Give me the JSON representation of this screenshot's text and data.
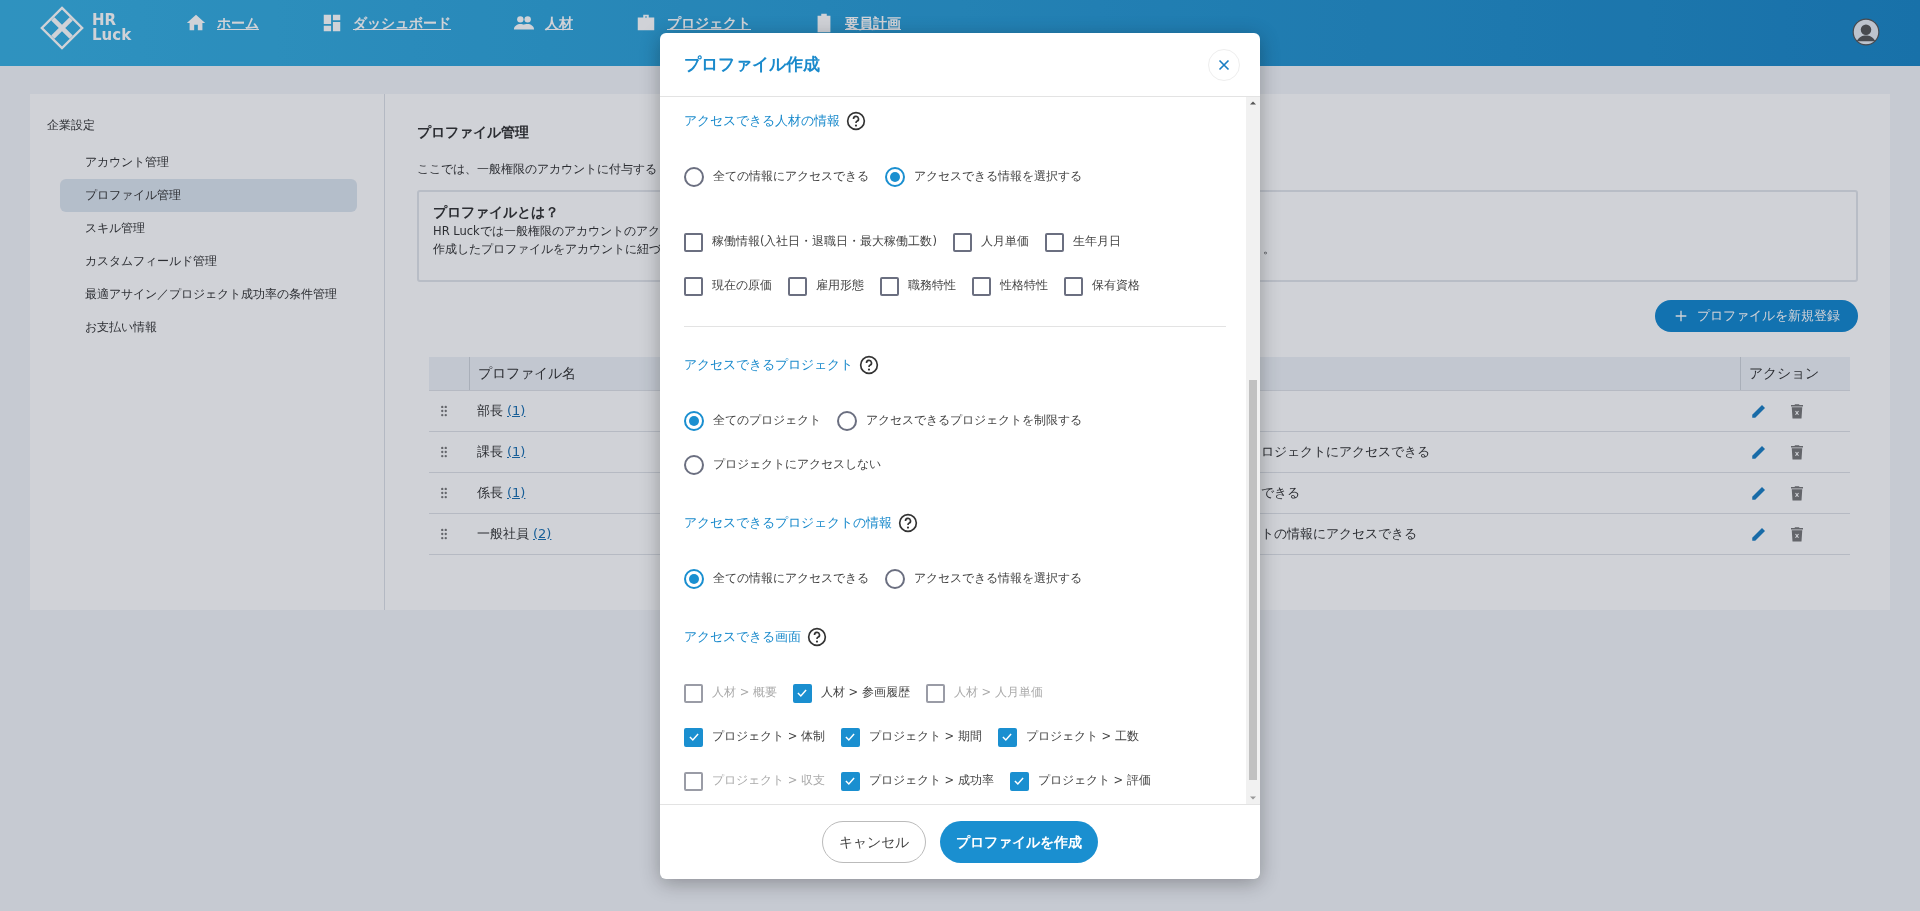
{
  "header": {
    "logo_lines": [
      "HR",
      "Luck"
    ],
    "nav": [
      {
        "kind": "home",
        "label": "ホーム"
      },
      {
        "kind": "dashboard",
        "label": "ダッシュボード"
      },
      {
        "kind": "people",
        "label": "人材"
      },
      {
        "kind": "briefcase",
        "label": "プロジェクト"
      },
      {
        "kind": "clipboard",
        "label": "要員計画"
      }
    ]
  },
  "sidebar": {
    "title": "企業設定",
    "items": [
      {
        "label": "アカウント管理",
        "selected": false
      },
      {
        "label": "プロファイル管理",
        "selected": true
      },
      {
        "label": "スキル管理",
        "selected": false
      },
      {
        "label": "カスタムフィールド管理",
        "selected": false
      },
      {
        "label": "最適アサイン／プロジェクト成功率の条件管理",
        "selected": false
      },
      {
        "label": "お支払い情報",
        "selected": false
      }
    ]
  },
  "main": {
    "title": "プロファイル管理",
    "description": "ここでは、一般権限のアカウントに付与する",
    "info": {
      "title": "プロファイルとは？",
      "lines": [
        "HR Luckでは一般権限のアカウントのアク",
        "作成したプロファイルをアカウントに紐づ"
      ],
      "line_tail": "。"
    },
    "new_button": "プロファイルを新規登録",
    "table": {
      "columns": [
        {
          "label": "プロファイル名"
        },
        {
          "label": "アクション"
        }
      ],
      "rows": [
        {
          "name": "部長",
          "count": "(1)"
        },
        {
          "name": "課長",
          "count": "(1)",
          "column_3": "ロジェクトにアクセスできる"
        },
        {
          "name": "係長",
          "count": "(1)",
          "column_3": "できる"
        },
        {
          "name": "一般社員",
          "count": "(2)",
          "column_3": "トの情報にアクセスできる"
        }
      ]
    }
  },
  "modal": {
    "title": "プロファイル作成",
    "sections": [
      {
        "heading": "アクセスできる人材の情報",
        "divider": true,
        "blocks": [
          {
            "kind": "radio",
            "options": [
              {
                "label": "全ての情報にアクセスできる",
                "selected": false
              },
              {
                "label": "アクセスできる情報を選択する",
                "selected": true
              }
            ]
          },
          {
            "kind": "checkbox",
            "options": [
              {
                "label": "稼働情報(入社日・退職日・最大稼働工数)",
                "checked": false,
                "disabled": false
              },
              {
                "label": "人月単価",
                "checked": false,
                "disabled": false
              },
              {
                "label": "生年月日",
                "checked": false,
                "disabled": false
              }
            ]
          },
          {
            "kind": "checkbox",
            "options": [
              {
                "label": "現在の原価",
                "checked": false,
                "disabled": false
              },
              {
                "label": "雇用形態",
                "checked": false,
                "disabled": false
              },
              {
                "label": "職務特性",
                "checked": false,
                "disabled": false
              },
              {
                "label": "性格特性",
                "checked": false,
                "disabled": false
              },
              {
                "label": "保有資格",
                "checked": false,
                "disabled": false
              }
            ]
          }
        ]
      },
      {
        "heading": "アクセスできるプロジェクト",
        "divider": false,
        "blocks": [
          {
            "kind": "radio",
            "options": [
              {
                "label": "全てのプロジェクト",
                "selected": true
              },
              {
                "label": "アクセスできるプロジェクトを制限する",
                "selected": false
              }
            ]
          },
          {
            "kind": "radio",
            "options": [
              {
                "label": "プロジェクトにアクセスしない",
                "selected": false
              }
            ]
          }
        ]
      },
      {
        "heading": "アクセスできるプロジェクトの情報",
        "divider": false,
        "blocks": [
          {
            "kind": "radio",
            "options": [
              {
                "label": "全ての情報にアクセスできる",
                "selected": true
              },
              {
                "label": "アクセスできる情報を選択する",
                "selected": false
              }
            ]
          }
        ]
      },
      {
        "heading": "アクセスできる画面",
        "divider": false,
        "blocks": [
          {
            "kind": "checkbox",
            "options": [
              {
                "label": "人材 > 概要",
                "checked": false,
                "disabled": true
              },
              {
                "label": "人材 > 参画履歴",
                "checked": true,
                "disabled": false
              },
              {
                "label": "人材 > 人月単価",
                "checked": false,
                "disabled": true
              }
            ]
          },
          {
            "kind": "checkbox",
            "options": [
              {
                "label": "プロジェクト > 体制",
                "checked": true,
                "disabled": false
              },
              {
                "label": "プロジェクト > 期間",
                "checked": true,
                "disabled": false
              },
              {
                "label": "プロジェクト > 工数",
                "checked": true,
                "disabled": false
              }
            ]
          },
          {
            "kind": "checkbox",
            "options": [
              {
                "label": "プロジェクト > 収支",
                "checked": false,
                "disabled": true
              },
              {
                "label": "プロジェクト > 成功率",
                "checked": true,
                "disabled": false
              },
              {
                "label": "プロジェクト > 評価",
                "checked": true,
                "disabled": false
              }
            ]
          }
        ]
      }
    ],
    "buttons": [
      {
        "kind": "cancel",
        "label": "キャンセル"
      },
      {
        "kind": "submit",
        "label": "プロファイルを作成"
      }
    ]
  }
}
